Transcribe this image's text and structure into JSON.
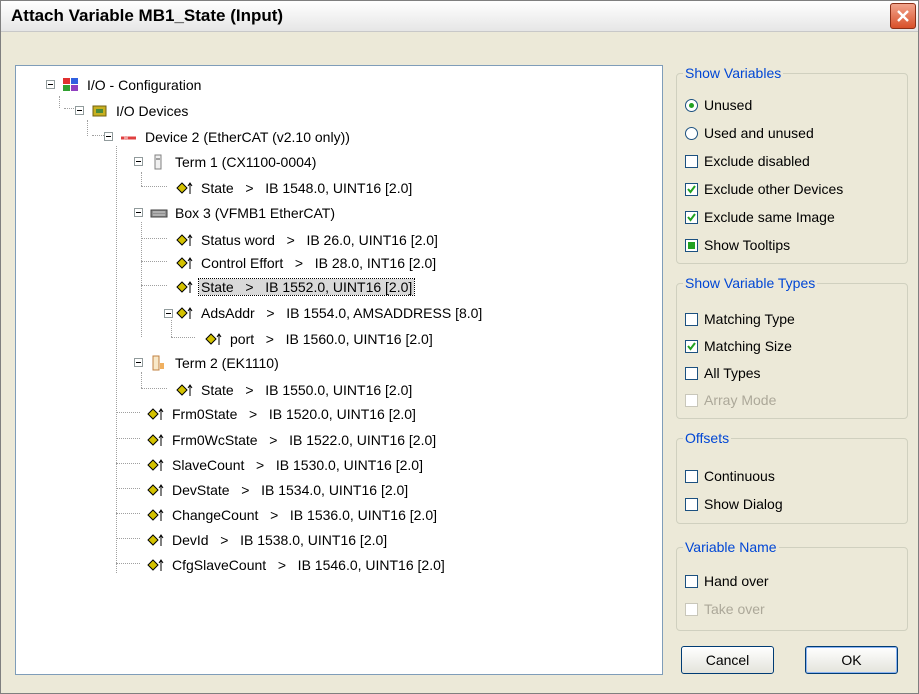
{
  "window": {
    "title": "Attach Variable MB1_State (Input)"
  },
  "tree": {
    "root": "I/O - Configuration",
    "devices": "I/O Devices",
    "device2": "Device 2 (EtherCAT (v2.10 only))",
    "term1": "Term 1 (CX1100-0004)",
    "term1_state": "State   >   IB 1548.0, UINT16 [2.0]",
    "box3": "Box 3 (VFMB1 EtherCAT)",
    "status_word": "Status word   >   IB 26.0, UINT16 [2.0]",
    "control_effort": "Control Effort   >   IB 28.0, INT16 [2.0]",
    "box3_state": "State   >   IB 1552.0, UINT16 [2.0]",
    "adsaddr": "AdsAddr   >   IB 1554.0, AMSADDRESS [8.0]",
    "port": "port   >   IB 1560.0, UINT16 [2.0]",
    "term2": "Term 2 (EK1110)",
    "term2_state": "State   >   IB 1550.0, UINT16 [2.0]",
    "frm0state": "Frm0State   >   IB 1520.0, UINT16 [2.0]",
    "frm0wcstate": "Frm0WcState   >   IB 1522.0, UINT16 [2.0]",
    "slavecount": "SlaveCount   >   IB 1530.0, UINT16 [2.0]",
    "devstate": "DevState   >   IB 1534.0, UINT16 [2.0]",
    "changecount": "ChangeCount   >   IB 1536.0, UINT16 [2.0]",
    "devid": "DevId   >   IB 1538.0, UINT16 [2.0]",
    "cfgslavecount": "CfgSlaveCount   >   IB 1546.0, UINT16 [2.0]"
  },
  "show_variables": {
    "title": "Show Variables",
    "unused": "Unused",
    "used_and_unused": "Used and unused",
    "exclude_disabled": "Exclude disabled",
    "exclude_other_devices": "Exclude other Devices",
    "exclude_same_image": "Exclude same Image",
    "show_tooltips": "Show Tooltips"
  },
  "show_variable_types": {
    "title": "Show Variable Types",
    "matching_type": "Matching Type",
    "matching_size": "Matching Size",
    "all_types": "All Types",
    "array_mode": "Array Mode"
  },
  "offsets": {
    "title": "Offsets",
    "continuous": "Continuous",
    "show_dialog": "Show Dialog"
  },
  "variable_name": {
    "title": "Variable Name",
    "hand_over": "Hand over",
    "take_over": "Take over"
  },
  "buttons": {
    "cancel": "Cancel",
    "ok": "OK"
  },
  "colors": {
    "group_title": "#0046d5",
    "check": "#21a121",
    "variable_icon": "#d4c200"
  }
}
